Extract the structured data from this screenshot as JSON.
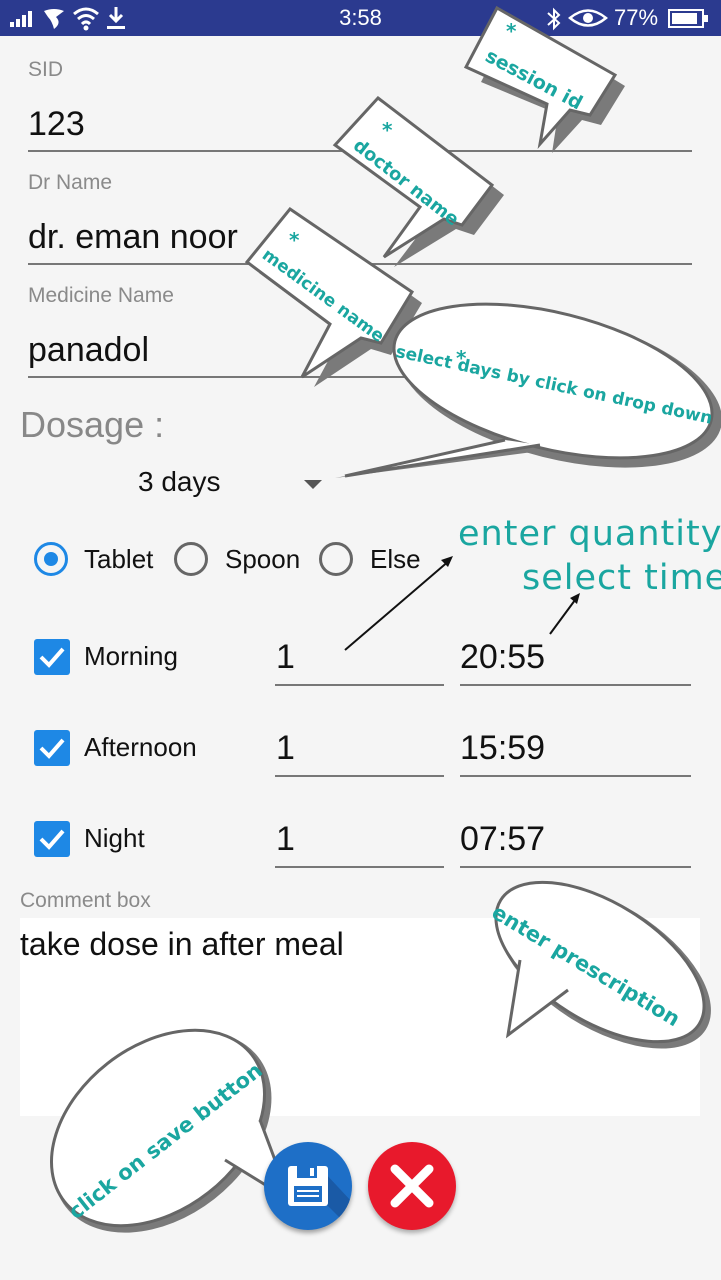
{
  "status_bar": {
    "time": "3:58",
    "battery": "77%"
  },
  "form": {
    "sid_label": "SID",
    "sid_value": "123",
    "dr_label": "Dr Name",
    "dr_value": "dr. eman noor",
    "medicine_label": "Medicine Name",
    "medicine_value": "panadol",
    "dosage_label": "Dosage :",
    "days_selected": "3 days",
    "dosage_types": [
      "Tablet",
      "Spoon",
      "Else"
    ],
    "dosage_type_selected": "Tablet",
    "schedule": [
      {
        "label": "Morning",
        "checked": true,
        "quantity": "1",
        "time": "20:55"
      },
      {
        "label": "Afternoon",
        "checked": true,
        "quantity": "1",
        "time": "15:59"
      },
      {
        "label": "Night",
        "checked": true,
        "quantity": "1",
        "time": "07:57"
      }
    ],
    "comment_label": "Comment box",
    "comment_value": "take dose in after meal"
  },
  "annotations": {
    "session_id": "session id",
    "doctor_name": "doctor name",
    "medicine_name": "medicine name",
    "select_days": "select days by click on drop down",
    "enter_quantity": "enter quantity",
    "select_time": "select time",
    "enter_prescription": "enter prescription",
    "click_save": "click on save button",
    "asterisk": "*"
  },
  "colors": {
    "status_bar": "#2b3a8f",
    "accent": "#1e88e5",
    "annotation_text": "#1aa6a0",
    "save_button": "#1e6fc7",
    "cancel_button": "#e8192c"
  },
  "icons": {
    "save": "floppy-disk-icon",
    "cancel": "close-icon"
  }
}
